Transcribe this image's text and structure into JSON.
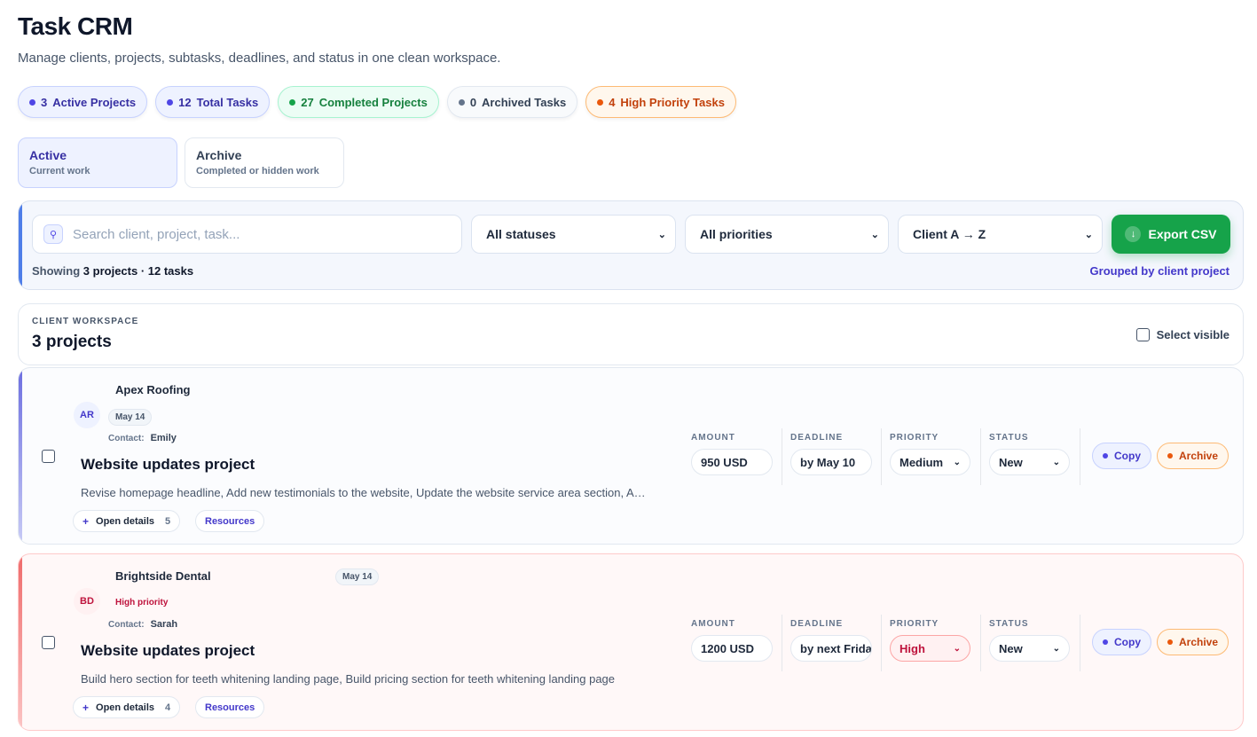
{
  "app": {
    "title": "Task CRM",
    "subtitle": "Manage clients, projects, subtasks, deadlines, and status in one clean workspace."
  },
  "stats": [
    {
      "count": "3",
      "label": "Active Projects",
      "tone": "blue"
    },
    {
      "count": "12",
      "label": "Total Tasks",
      "tone": "blue"
    },
    {
      "count": "27",
      "label": "Completed Projects",
      "tone": "green"
    },
    {
      "count": "0",
      "label": "Archived Tasks",
      "tone": "gray"
    },
    {
      "count": "4",
      "label": "High Priority Tasks",
      "tone": "orange"
    }
  ],
  "tabs": [
    {
      "label": "Active",
      "sub": "Current work",
      "selected": true
    },
    {
      "label": "Archive",
      "sub": "Completed or hidden work",
      "selected": false
    }
  ],
  "filters": {
    "search_placeholder": "Search client, project, task...",
    "status": "All statuses",
    "priority": "All priorities",
    "sort": "Client A → Z",
    "export_label": "Export CSV",
    "showing_prefix": "Showing",
    "showing_count": "3 projects · 12 tasks",
    "grouped": "Grouped by client project"
  },
  "workspace": {
    "kicker": "CLIENT WORKSPACE",
    "count": "3 projects",
    "select_visible": "Select visible"
  },
  "columns": {
    "amount": "AMOUNT",
    "deadline": "DEADLINE",
    "priority": "PRIORITY",
    "status": "STATUS"
  },
  "projects": [
    {
      "initials": "AR",
      "client": "Apex Roofing",
      "date": "May 14",
      "high_priority": "",
      "contact_label": "Contact:",
      "contact": "Emily",
      "name": "Website updates project",
      "description": "Revise homepage headline, Add new testimonials to the website, Update the website service area section, Add new project photos",
      "open_details": "Open details",
      "task_count": "5",
      "resources": "Resources",
      "amount": "950 USD",
      "deadline": "by May 10",
      "priority": "Medium",
      "status": "New",
      "copy": "Copy",
      "archive": "Archive"
    },
    {
      "initials": "BD",
      "client": "Brightside Dental",
      "date": "May 14",
      "high_priority": "High priority",
      "contact_label": "Contact:",
      "contact": "Sarah",
      "name": "Website updates project",
      "description": "Build hero section for teeth whitening landing page, Build pricing section for teeth whitening landing page",
      "open_details": "Open details",
      "task_count": "4",
      "resources": "Resources",
      "amount": "1200 USD",
      "deadline": "by next Friday",
      "priority": "High",
      "status": "New",
      "copy": "Copy",
      "archive": "Archive"
    }
  ]
}
